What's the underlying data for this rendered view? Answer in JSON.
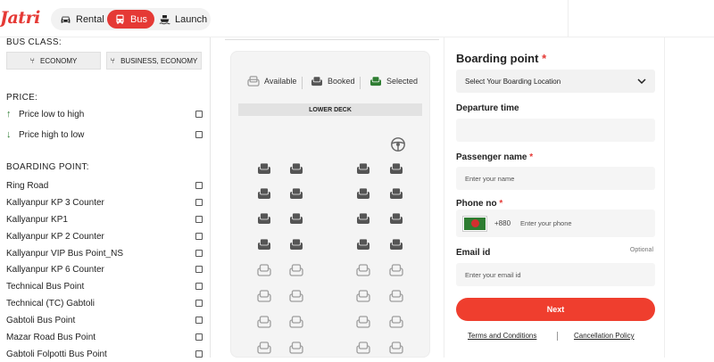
{
  "header": {
    "logo": "Jatri",
    "nav": [
      {
        "label": "Rental",
        "icon": "car-icon",
        "active": false
      },
      {
        "label": "Bus",
        "icon": "bus-icon",
        "active": true
      },
      {
        "label": "Launch",
        "icon": "ship-icon",
        "active": false
      }
    ]
  },
  "sidebar": {
    "bus_class_title": "BUS CLASS:",
    "bus_classes": [
      "ECONOMY",
      "BUSINESS, ECONOMY"
    ],
    "price_title": "PRICE:",
    "price_options": [
      "Price low to high",
      "Price high to low"
    ],
    "boarding_title": "BOARDING POINT:",
    "boarding_points": [
      "Ring Road",
      "Kallyanpur KP 3 Counter",
      "Kallyanpur KP1",
      "Kallyanpur KP 2 Counter",
      "Kallyanpur VIP Bus Point_NS",
      "Kallyanpur KP 6 Counter",
      "Technical Bus Point",
      "Technical (TC) Gabtoli",
      "Gabtoli Bus Point",
      "Mazar Road Bus Point",
      "Gabtoli Folpotti Bus Point"
    ]
  },
  "seat_map": {
    "legend": [
      "Available",
      "Booked",
      "Selected"
    ],
    "deck_label": "LOWER DECK",
    "legend_colors": {
      "available": "#9e9e9e",
      "booked": "#555555",
      "selected": "#2e7d32"
    }
  },
  "form": {
    "boarding_label": "Boarding point",
    "boarding_select": "Select Your Boarding Location",
    "departure_label": "Departure time",
    "passenger_label": "Passenger name",
    "passenger_placeholder": "Enter your name",
    "phone_label": "Phone no",
    "phone_code": "+880",
    "phone_placeholder": "Enter your phone",
    "email_label": "Email id",
    "email_optional": "Optional",
    "email_placeholder": "Enter your email id",
    "required_mark": "*",
    "next_label": "Next",
    "terms_link": "Terms and Conditions",
    "cancel_link": "Cancellation Policy",
    "accent": "#ef3e2e"
  }
}
